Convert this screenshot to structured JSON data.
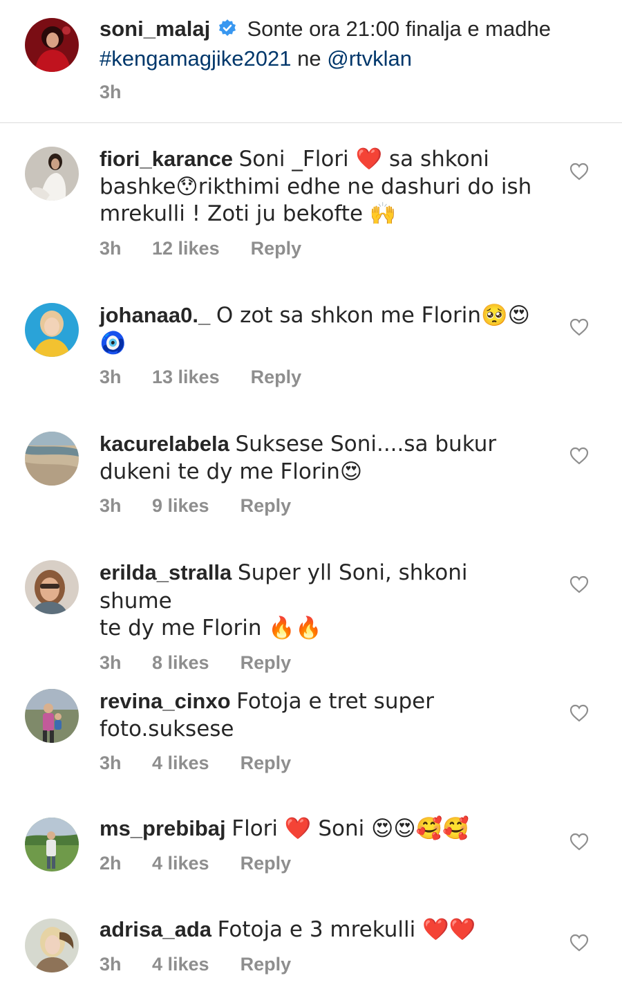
{
  "caption": {
    "username": "soni_malaj",
    "text_part1": " Sonte ora 21:00 finalja e madhe",
    "hashtag": "#kengamagjike2021",
    "text_part2": " ne ",
    "mention": "@rtvklan",
    "time": "3h"
  },
  "comments": [
    {
      "username": "fiori_karance",
      "lines": [
        "Soni _Flori ❤️ sa shkoni",
        "bashke😯rikthimi edhe ne dashuri do ish",
        "mrekulli ! Zoti ju bekofte 🙌"
      ],
      "time": "3h",
      "likes": "12 likes",
      "reply": "Reply"
    },
    {
      "username": "johanaa0._",
      "lines": [
        "O zot sa shkon me Florin🥺😍",
        "🧿"
      ],
      "time": "3h",
      "likes": "13 likes",
      "reply": "Reply"
    },
    {
      "username": "kacurelabela",
      "lines": [
        "Suksese Soni....sa bukur",
        "dukeni te dy me Florin😍"
      ],
      "time": "3h",
      "likes": "9 likes",
      "reply": "Reply"
    },
    {
      "username": "erilda_stralla",
      "lines": [
        "Super yll Soni, shkoni shume",
        "te dy me Florin 🔥🔥"
      ],
      "time": "3h",
      "likes": "8 likes",
      "reply": "Reply"
    },
    {
      "username": "revina_cinxo",
      "lines": [
        "Fotoja e tret super",
        "foto.suksese"
      ],
      "time": "3h",
      "likes": "4 likes",
      "reply": "Reply"
    },
    {
      "username": "ms_prebibaj",
      "lines": [
        "Flori ❤️ Soni 😍😍🥰🥰"
      ],
      "time": "2h",
      "likes": "4 likes",
      "reply": "Reply"
    },
    {
      "username": "adrisa_ada",
      "lines": [
        "Fotoja e 3 mrekulli ❤️❤️"
      ],
      "time": "3h",
      "likes": "4 likes",
      "reply": "Reply"
    }
  ],
  "colors": {
    "text": "#262626",
    "secondary": "#8e8e8e",
    "link": "#00376b",
    "verified": "#3897f0",
    "divider": "#dbdbdb"
  },
  "icons": {
    "verified": "verified-badge-icon",
    "like": "heart-outline-icon"
  }
}
